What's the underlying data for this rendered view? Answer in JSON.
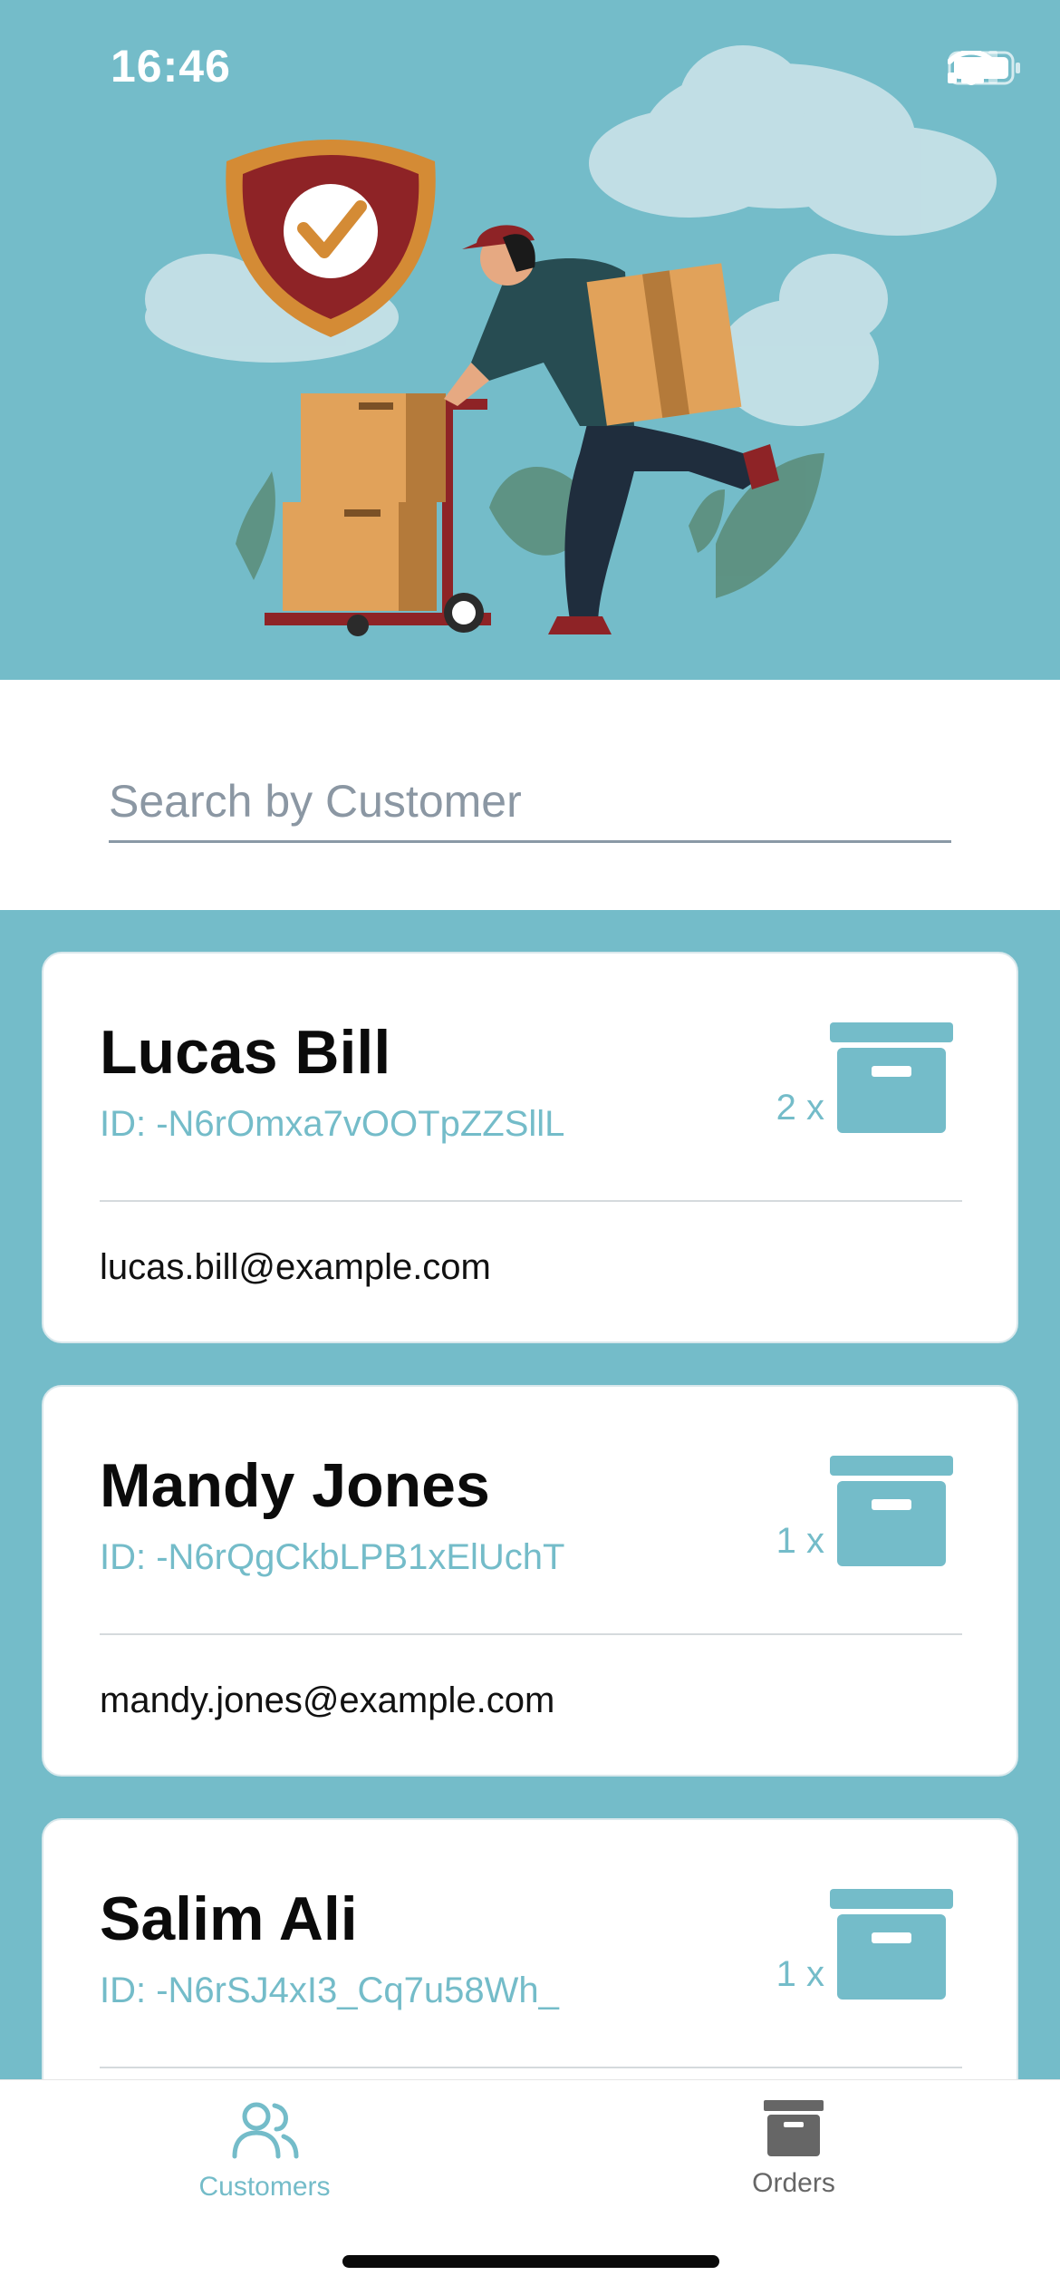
{
  "status_bar": {
    "time": "16:46"
  },
  "search": {
    "placeholder": "Search by Customer",
    "value": ""
  },
  "colors": {
    "accent": "#74bcc9",
    "inactive": "#666666"
  },
  "customers": [
    {
      "name": "Lucas Bill",
      "id": "ID: -N6rOmxa7vOOTpZZSllL",
      "order_count": "2 x",
      "email": "lucas.bill@example.com"
    },
    {
      "name": "Mandy Jones",
      "id": "ID: -N6rQgCkbLPB1xElUchT",
      "order_count": "1 x",
      "email": "mandy.jones@example.com"
    },
    {
      "name": "Salim Ali",
      "id": "ID: -N6rSJ4xI3_Cq7u58Wh_",
      "order_count": "1 x",
      "email": ""
    }
  ],
  "tabs": [
    {
      "label": "Customers",
      "icon": "users-icon",
      "active": true
    },
    {
      "label": "Orders",
      "icon": "archive-box-icon",
      "active": false
    }
  ]
}
